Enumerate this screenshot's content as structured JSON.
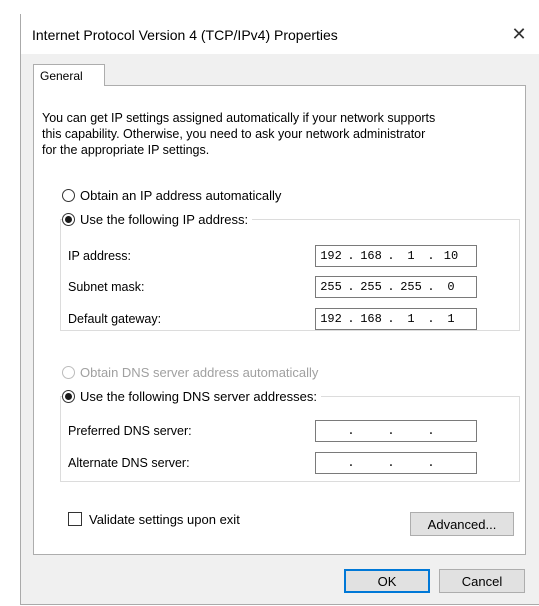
{
  "window": {
    "title": "Internet Protocol Version 4 (TCP/IPv4) Properties",
    "close_glyph": "✕"
  },
  "tabs": [
    {
      "label": "General",
      "active": true
    }
  ],
  "general": {
    "description_line1": "You can get IP settings assigned automatically if your network supports",
    "description_line2": "this capability. Otherwise, you need to ask your network administrator",
    "description_line3": "for the appropriate IP settings.",
    "ip_mode": {
      "auto_label": "Obtain an IP address automatically",
      "auto_checked": false,
      "manual_label": "Use the following IP address:",
      "manual_checked": true
    },
    "ip_fields": {
      "ip_address": {
        "label": "IP address:",
        "octets": [
          "192",
          "168",
          "1",
          "10"
        ]
      },
      "subnet_mask": {
        "label": "Subnet mask:",
        "octets": [
          "255",
          "255",
          "255",
          "0"
        ]
      },
      "default_gateway": {
        "label": "Default gateway:",
        "octets": [
          "192",
          "168",
          "1",
          "1"
        ]
      }
    },
    "dns_mode": {
      "auto_label": "Obtain DNS server address automatically",
      "auto_checked": false,
      "auto_disabled": true,
      "manual_label": "Use the following DNS server addresses:",
      "manual_checked": true
    },
    "dns_fields": {
      "preferred": {
        "label": "Preferred DNS server:",
        "octets": [
          "",
          "",
          "",
          ""
        ]
      },
      "alternate": {
        "label": "Alternate DNS server:",
        "octets": [
          "",
          "",
          "",
          ""
        ]
      }
    },
    "validate": {
      "label": "Validate settings upon exit",
      "checked": false
    },
    "advanced_label": "Advanced..."
  },
  "footer": {
    "ok_label": "OK",
    "cancel_label": "Cancel"
  },
  "colors": {
    "window_bg": "#f0f0f0",
    "panel_bg": "#ffffff",
    "default_button_border": "#0078d7",
    "disabled_text": "#a0a0a0"
  },
  "icons": {
    "close": "close-icon"
  }
}
